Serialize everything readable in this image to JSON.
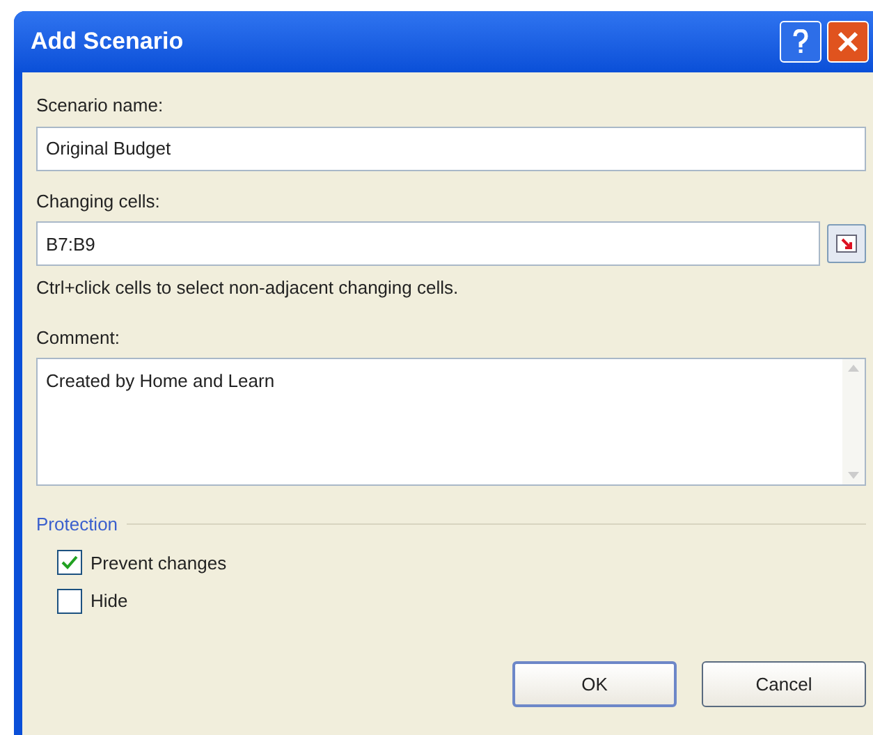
{
  "window": {
    "title": "Add Scenario"
  },
  "fields": [
    {
      "label": "Scenario name:",
      "value": "Original Budget"
    },
    {
      "label": "Changing cells:",
      "value": "B7:B9",
      "hint": "Ctrl+click cells to select non-adjacent changing cells."
    }
  ],
  "comment": {
    "label": "Comment:",
    "value": "Created by Home and Learn"
  },
  "protection": {
    "title": "Protection",
    "options": [
      {
        "label": "Prevent changes",
        "checked": true
      },
      {
        "label": "Hide",
        "checked": false
      }
    ]
  },
  "buttons": [
    "OK",
    "Cancel"
  ]
}
